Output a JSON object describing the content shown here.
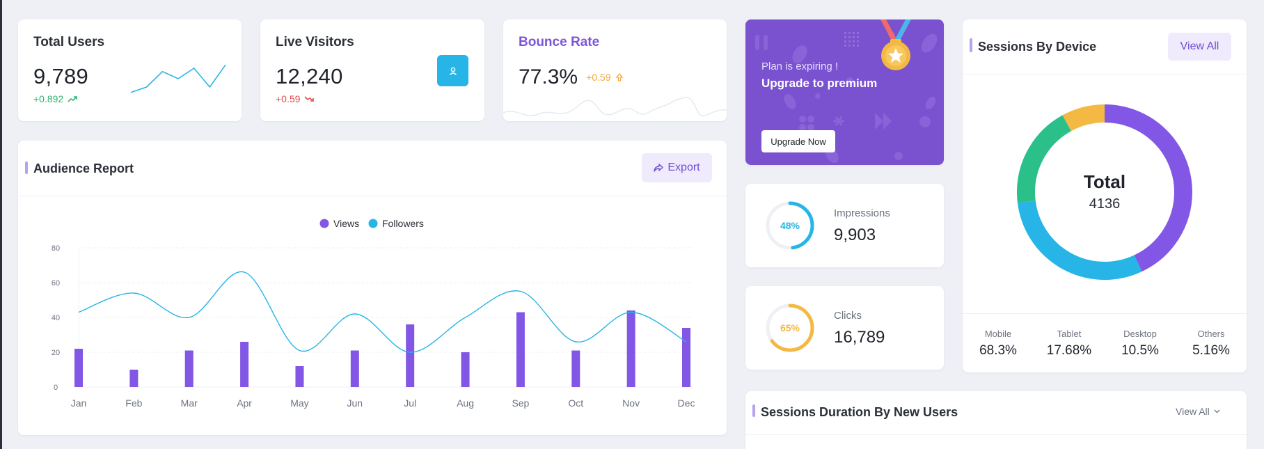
{
  "stats": {
    "total_users": {
      "title": "Total Users",
      "value": "9,789",
      "change": "+0.892",
      "trend": [
        0.22,
        0.35,
        0.72,
        0.55,
        0.8,
        0.35,
        0.88
      ]
    },
    "live_visitors": {
      "title": "Live Visitors",
      "value": "12,240",
      "change": "+0.59"
    },
    "bounce_rate": {
      "title": "Bounce Rate",
      "value": "77.3%",
      "change": "+0.59"
    }
  },
  "promo": {
    "subtitle": "Plan is expiring !",
    "title": "Upgrade to premium",
    "button": "Upgrade Now"
  },
  "audience": {
    "title": "Audience Report",
    "export_label": "Export",
    "chart_data": {
      "type": "bar",
      "categories": [
        "Jan",
        "Feb",
        "Mar",
        "Apr",
        "May",
        "Jun",
        "Jul",
        "Aug",
        "Sep",
        "Oct",
        "Nov",
        "Dec"
      ],
      "series": [
        {
          "name": "Views",
          "type": "bar",
          "color": "#8257e5",
          "values": [
            22,
            10,
            21,
            26,
            12,
            21,
            36,
            20,
            43,
            21,
            44,
            34
          ]
        },
        {
          "name": "Followers",
          "type": "line",
          "color": "#26b5e6",
          "values": [
            43,
            54,
            40,
            66,
            21,
            42,
            20,
            40,
            55,
            26,
            43,
            26
          ]
        }
      ],
      "yticks": [
        "0",
        "20",
        "40",
        "60",
        "80"
      ],
      "ylim": [
        0,
        80
      ],
      "grid": true,
      "legend": "top-center"
    }
  },
  "impressions": {
    "percent": "48%",
    "fraction": 0.48,
    "label": "Impressions",
    "value": "9,903",
    "color": "#26b5e6"
  },
  "clicks": {
    "percent": "65%",
    "fraction": 0.65,
    "label": "Clicks",
    "value": "16,789",
    "color": "#f4b942"
  },
  "sessions_device": {
    "title": "Sessions By Device",
    "view_all": "View All",
    "total_label": "Total",
    "total_value": "4136",
    "chart_data": {
      "type": "pie",
      "slices": [
        {
          "name": "Mobile",
          "value": 43,
          "color": "#8257e5"
        },
        {
          "name": "Tablet",
          "value": 30,
          "color": "#26b5e6"
        },
        {
          "name": "Desktop",
          "value": 19,
          "color": "#2bc08a"
        },
        {
          "name": "Others",
          "value": 8,
          "color": "#f4b942"
        }
      ]
    },
    "stats": [
      {
        "label": "Mobile",
        "value": "68.3%"
      },
      {
        "label": "Tablet",
        "value": "17.68%"
      },
      {
        "label": "Desktop",
        "value": "10.5%"
      },
      {
        "label": "Others",
        "value": "5.16%"
      }
    ]
  },
  "sessions_duration": {
    "title": "Sessions Duration By New Users",
    "view_all": "View All"
  },
  "colors": {
    "accent": "#8257e5",
    "info": "#26b5e6",
    "success": "#2bb673",
    "danger": "#e04c4c",
    "warning": "#f4a93c"
  }
}
